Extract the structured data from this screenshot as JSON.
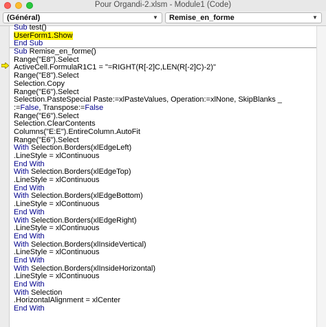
{
  "window": {
    "title": "Pour Organdi-2.xlsm - Module1 (Code)"
  },
  "dropdowns": {
    "object": "(Général)",
    "procedure": "Remise_en_forme"
  },
  "colors": {
    "keyword": "#00008b",
    "highlight": "#fff200",
    "arrow": "#f5e600"
  },
  "code_lines": [
    {
      "kw": "Sub",
      "text": " test()"
    },
    {
      "text": "UserForm1.Show",
      "hl": true
    },
    {
      "kw": "End Sub",
      "text": ""
    },
    {
      "kw": "Sub",
      "text": " Remise_en_forme()"
    },
    {
      "text": "Range(\"E8\").Select"
    },
    {
      "text": "ActiveCell.FormulaR1C1 = \"=RIGHT(R[-2]C,LEN(R[-2]C)-2)\""
    },
    {
      "text": "Range(\"E8\").Select"
    },
    {
      "text": "Selection.Copy"
    },
    {
      "text": "Range(\"E6\").Select"
    },
    {
      "text": "Selection.PasteSpecial Paste:=xlPasteValues, Operation:=xlNone, SkipBlanks _"
    },
    {
      "text": ":=",
      "kw2": "False",
      "text2": ", Transpose:=",
      "kw3": "False"
    },
    {
      "text": "Range(\"E6\").Select"
    },
    {
      "text": "Selection.ClearContents"
    },
    {
      "text": "Columns(\"E:E\").EntireColumn.AutoFit"
    },
    {
      "text": "Range(\"E6\").Select"
    },
    {
      "kw": "With",
      "text": " Selection.Borders(xlEdgeLeft)"
    },
    {
      "text": ".LineStyle = xlContinuous"
    },
    {
      "kw": "End With",
      "text": ""
    },
    {
      "kw": "With",
      "text": " Selection.Borders(xlEdgeTop)"
    },
    {
      "text": ".LineStyle = xlContinuous"
    },
    {
      "kw": "End With",
      "text": ""
    },
    {
      "kw": "With",
      "text": " Selection.Borders(xlEdgeBottom)"
    },
    {
      "text": ".LineStyle = xlContinuous"
    },
    {
      "kw": "End With",
      "text": ""
    },
    {
      "kw": "With",
      "text": " Selection.Borders(xlEdgeRight)"
    },
    {
      "text": ".LineStyle = xlContinuous"
    },
    {
      "kw": "End With",
      "text": ""
    },
    {
      "kw": "With",
      "text": " Selection.Borders(xlInsideVertical)"
    },
    {
      "text": ".LineStyle = xlContinuous"
    },
    {
      "kw": "End With",
      "text": ""
    },
    {
      "kw": "With",
      "text": " Selection.Borders(xlInsideHorizontal)"
    },
    {
      "text": ".LineStyle = xlContinuous"
    },
    {
      "kw": "End With",
      "text": ""
    },
    {
      "kw": "With",
      "text": " Selection"
    },
    {
      "text": ".HorizontalAlignment = xlCenter"
    },
    {
      "kw": "End With",
      "text": ""
    }
  ]
}
